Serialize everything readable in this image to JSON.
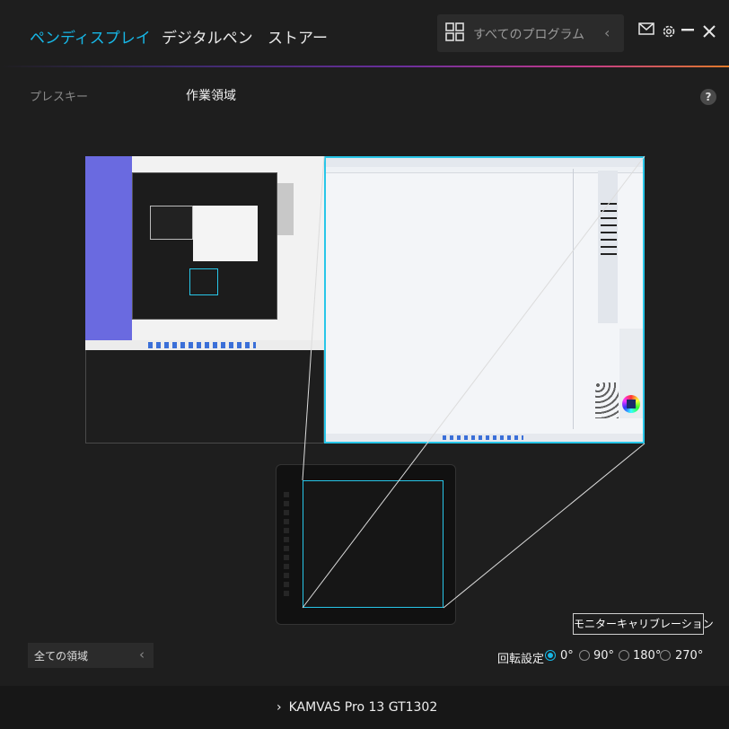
{
  "tabs": [
    {
      "label": "ペンディスプレイ",
      "active": true
    },
    {
      "label": "デジタルペン",
      "active": false
    },
    {
      "label": "ストアー",
      "active": false
    }
  ],
  "search": {
    "placeholder": "すべてのプログラム"
  },
  "subtabs": [
    {
      "label": "プレスキー"
    },
    {
      "label": "作業領域"
    }
  ],
  "help": {
    "label": "?"
  },
  "calibration": {
    "label": "モニターキャリブレーション"
  },
  "region_select": {
    "value": "全ての領域"
  },
  "rotation": {
    "label": "回転設定",
    "options": [
      {
        "label": "0°",
        "selected": true
      },
      {
        "label": "90°",
        "selected": false
      },
      {
        "label": "180°",
        "selected": false
      },
      {
        "label": "270°",
        "selected": false
      }
    ]
  },
  "device": {
    "name": "KAMVAS Pro 13 GT1302"
  },
  "colors": {
    "accent": "#17b7e6",
    "background": "#1e1e1e",
    "panel": "#2b2b2b"
  }
}
